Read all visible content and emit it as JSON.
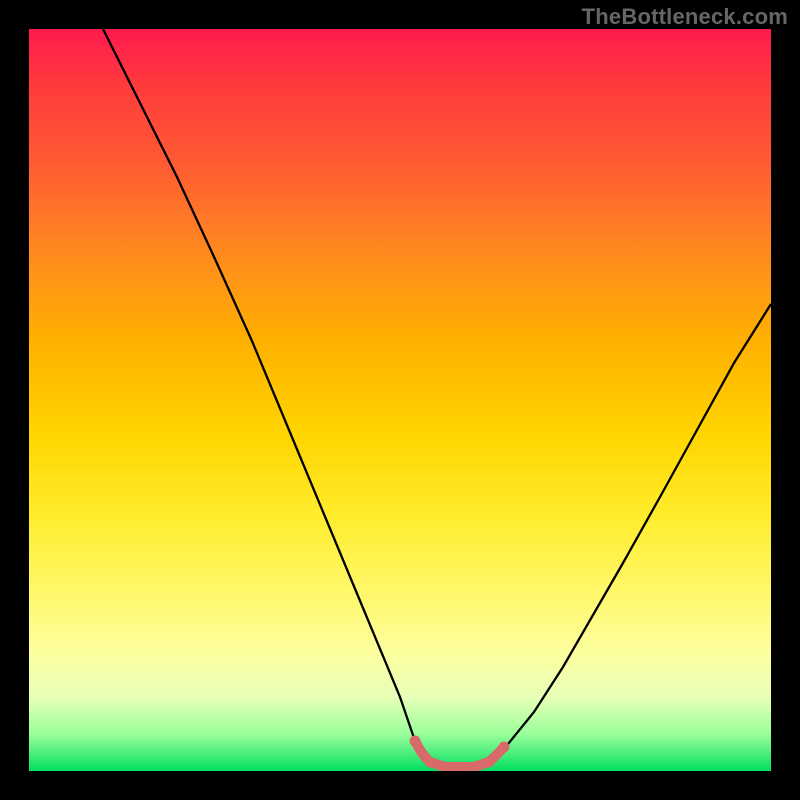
{
  "watermark": "TheBottleneck.com",
  "chart_data": {
    "type": "line",
    "title": "",
    "xlabel": "",
    "ylabel": "",
    "xlim": [
      0,
      100
    ],
    "ylim": [
      0,
      100
    ],
    "background_gradient": {
      "top_color": "#ff1a4d",
      "bottom_color": "#00e060",
      "meaning": "red = high bottleneck, green = low bottleneck"
    },
    "series": [
      {
        "name": "bottleneck-curve",
        "color": "#000000",
        "x": [
          10,
          15,
          20,
          25,
          30,
          35,
          40,
          45,
          50,
          52,
          54,
          56,
          58,
          60,
          62,
          64,
          68,
          72,
          76,
          80,
          85,
          90,
          95,
          100
        ],
        "y": [
          100,
          90,
          80,
          69,
          58,
          46,
          34,
          22,
          10,
          4,
          1,
          0,
          0,
          0,
          1,
          3,
          8,
          14,
          21,
          28,
          37,
          46,
          55,
          63
        ]
      },
      {
        "name": "match-zone",
        "color": "#e06666",
        "style": "dotted-thick",
        "x": [
          52,
          54,
          56,
          58,
          60,
          62,
          64
        ],
        "y": [
          4,
          1,
          0,
          0,
          0,
          1,
          3
        ]
      }
    ],
    "optimal_x_range": [
      52,
      64
    ]
  }
}
